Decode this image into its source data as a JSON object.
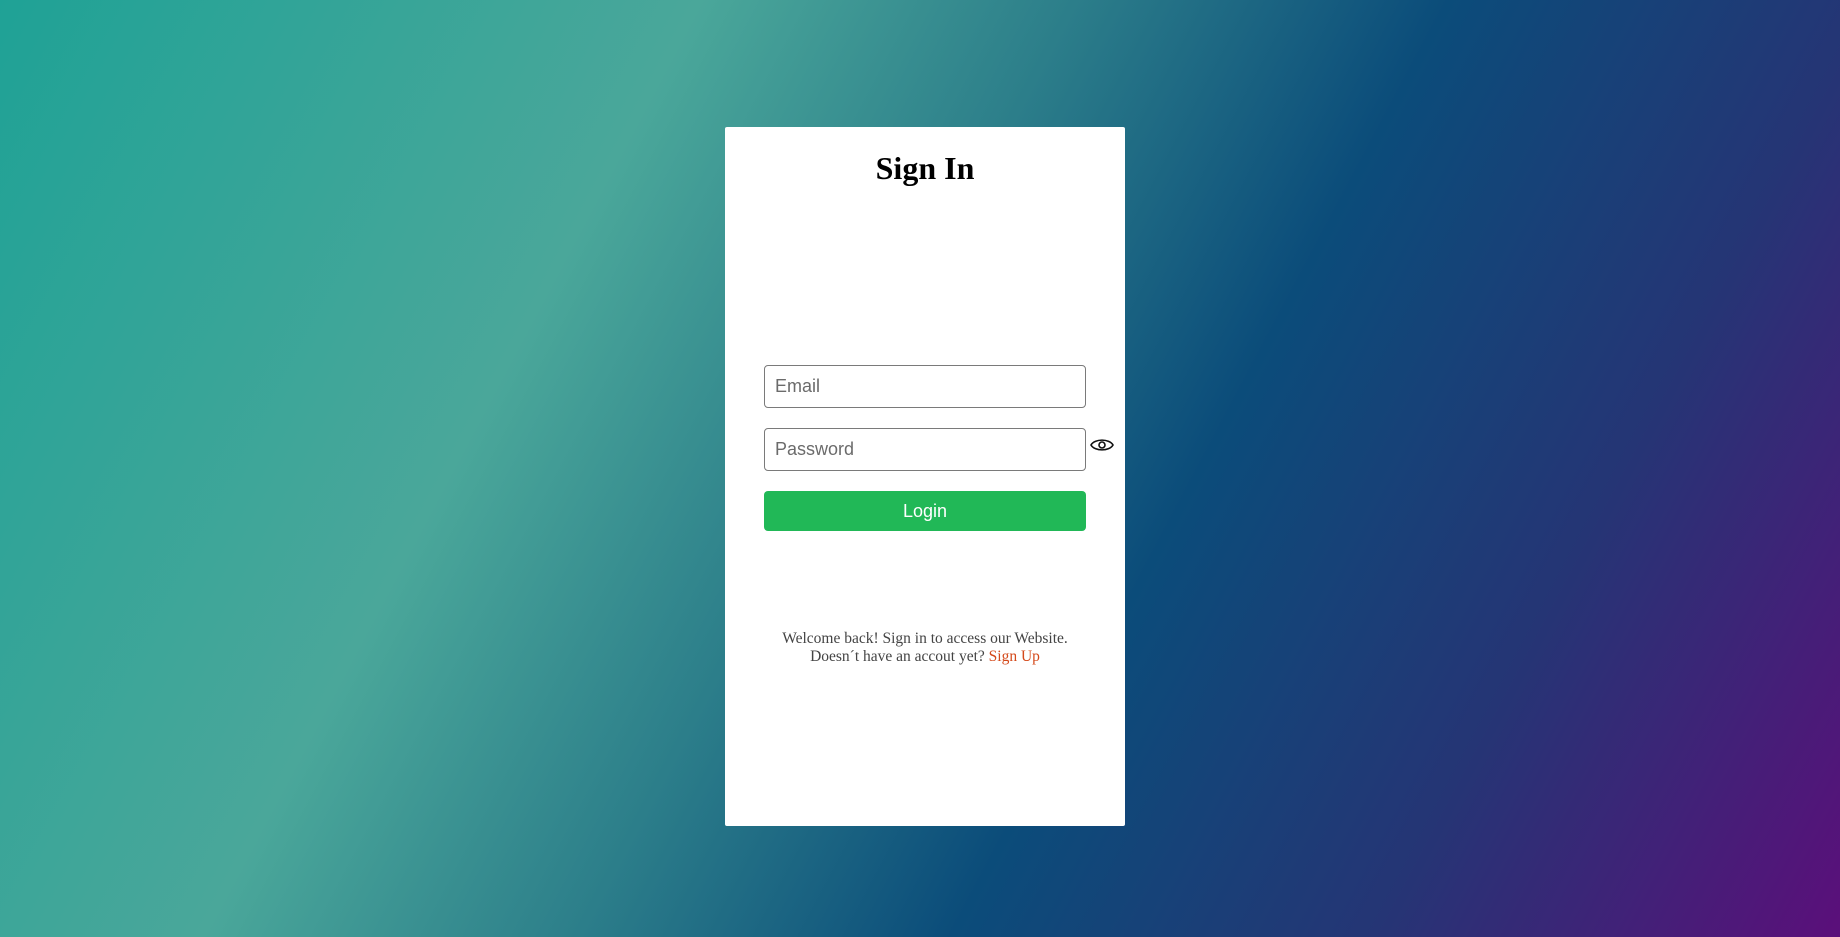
{
  "signin": {
    "title": "Sign In",
    "email_placeholder": "Email",
    "password_placeholder": "Password",
    "login_label": "Login",
    "welcome_text": "Welcome back! Sign in to access our Website.",
    "no_account_text": "Doesn´t have an accout yet?",
    "signup_label": "Sign Up"
  },
  "icons": {
    "password_toggle": "eye-icon"
  },
  "colors": {
    "login_button": "#21b857",
    "signup_link": "#d4491a",
    "card_background": "#ffffff"
  }
}
